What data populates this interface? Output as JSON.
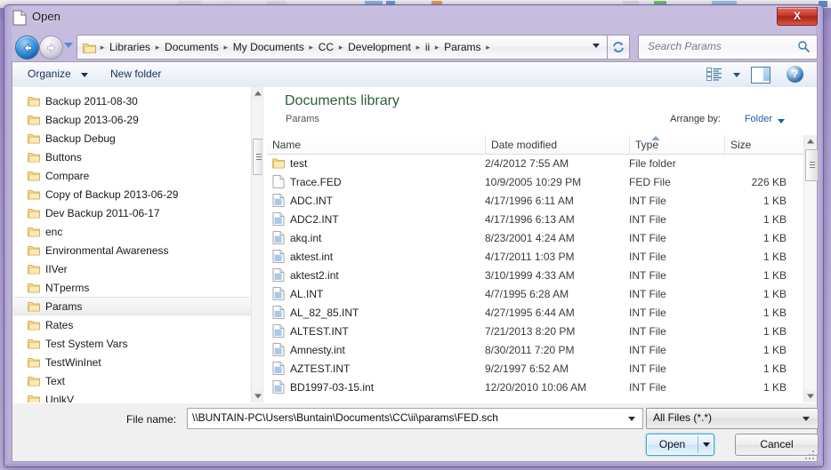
{
  "window": {
    "title": "Open",
    "close_label": "X",
    "icon": "document-window-icon"
  },
  "address_bar": {
    "back_icon": "back-arrow-icon",
    "forward_icon": "forward-arrow-icon",
    "recent_locations_icon": "chevron-down-icon",
    "folder_icon": "folder-icon",
    "breadcrumbs": [
      "Libraries",
      "Documents",
      "My Documents",
      "CC",
      "Development",
      "ii",
      "Params"
    ],
    "separator": "▸",
    "refresh_icon": "refresh-icon",
    "dropdown_icon": "chevron-down-icon"
  },
  "search": {
    "placeholder": "Search Params",
    "icon": "search-icon"
  },
  "toolbar": {
    "organize_label": "Organize",
    "new_folder_label": "New folder",
    "view_mode_icon": "list-view-icon",
    "preview_pane_icon": "preview-pane-icon",
    "help_icon": "help-icon",
    "help_glyph": "?"
  },
  "nav_pane": {
    "items": [
      {
        "label": "Backup 2011-08-30",
        "selected": false
      },
      {
        "label": "Backup 2013-06-29",
        "selected": false
      },
      {
        "label": "Backup Debug",
        "selected": false
      },
      {
        "label": "Buttons",
        "selected": false
      },
      {
        "label": "Compare",
        "selected": false
      },
      {
        "label": "Copy of Backup 2013-06-29",
        "selected": false
      },
      {
        "label": "Dev Backup 2011-06-17",
        "selected": false
      },
      {
        "label": "enc",
        "selected": false
      },
      {
        "label": "Environmental Awareness",
        "selected": false
      },
      {
        "label": "IIVer",
        "selected": false
      },
      {
        "label": "NTperms",
        "selected": false
      },
      {
        "label": "Params",
        "selected": true
      },
      {
        "label": "Rates",
        "selected": false
      },
      {
        "label": "Test System Vars",
        "selected": false
      },
      {
        "label": "TestWinInet",
        "selected": false
      },
      {
        "label": "Text",
        "selected": false
      },
      {
        "label": "UnlkV",
        "selected": false
      }
    ],
    "folder_icon": "folder-icon",
    "scroll_up_icon": "scroll-up-arrow-icon",
    "scroll_down_icon": "scroll-down-arrow-icon"
  },
  "library": {
    "title": "Documents library",
    "subtitle": "Params",
    "arrange_label": "Arrange by:",
    "arrange_value": "Folder",
    "arrange_caret_icon": "chevron-down-icon"
  },
  "file_list": {
    "columns": [
      "Name",
      "Date modified",
      "Type",
      "Size"
    ],
    "sort_column": "Type",
    "sort_direction": "ascending",
    "sort_icon": "sort-ascending-icon",
    "rows": [
      {
        "name": "test",
        "date": "2/4/2012 7:55 AM",
        "type": "File folder",
        "size": "",
        "icon": "folder-icon"
      },
      {
        "name": "Trace.FED",
        "date": "10/9/2005 10:29 PM",
        "type": "FED File",
        "size": "226 KB",
        "icon": "blank-file-icon"
      },
      {
        "name": "ADC.INT",
        "date": "4/17/1996 6:11 AM",
        "type": "INT File",
        "size": "1 KB",
        "icon": "int-file-icon"
      },
      {
        "name": "ADC2.INT",
        "date": "4/17/1996 6:13 AM",
        "type": "INT File",
        "size": "1 KB",
        "icon": "int-file-icon"
      },
      {
        "name": "akq.int",
        "date": "8/23/2001 4:24 AM",
        "type": "INT File",
        "size": "1 KB",
        "icon": "int-file-icon"
      },
      {
        "name": "aktest.int",
        "date": "4/17/2011 1:03 PM",
        "type": "INT File",
        "size": "1 KB",
        "icon": "int-file-icon"
      },
      {
        "name": "aktest2.int",
        "date": "3/10/1999 4:33 AM",
        "type": "INT File",
        "size": "1 KB",
        "icon": "int-file-icon"
      },
      {
        "name": "AL.INT",
        "date": "4/7/1995 6:28 AM",
        "type": "INT File",
        "size": "1 KB",
        "icon": "int-file-icon"
      },
      {
        "name": "AL_82_85.INT",
        "date": "4/27/1995 6:44 AM",
        "type": "INT File",
        "size": "1 KB",
        "icon": "int-file-icon"
      },
      {
        "name": "ALTEST.INT",
        "date": "7/21/2013 8:20 PM",
        "type": "INT File",
        "size": "1 KB",
        "icon": "int-file-icon"
      },
      {
        "name": "Amnesty.int",
        "date": "8/30/2011 7:20 PM",
        "type": "INT File",
        "size": "1 KB",
        "icon": "int-file-icon"
      },
      {
        "name": "AZTEST.INT",
        "date": "9/2/1997 6:52 AM",
        "type": "INT File",
        "size": "1 KB",
        "icon": "int-file-icon"
      },
      {
        "name": "BD1997-03-15.int",
        "date": "12/20/2010 10:06 AM",
        "type": "INT File",
        "size": "1 KB",
        "icon": "int-file-icon"
      }
    ]
  },
  "footer": {
    "file_name_label": "File name:",
    "file_name_value": "\\\\BUNTAIN-PC\\Users\\Buntain\\Documents\\CC\\ii\\params\\FED.sch",
    "file_name_caret_icon": "chevron-down-icon",
    "filter_value": "All Files (*.*)",
    "filter_caret_icon": "chevron-down-icon",
    "open_label": "Open",
    "open_caret_icon": "chevron-down-icon",
    "cancel_label": "Cancel",
    "resize_grip_icon": "resize-grip-icon"
  },
  "colors": {
    "glass": "#bdb2da",
    "library_title": "#2a6136",
    "link": "#1a5fa8",
    "accent_button_border": "#3fa3d4",
    "close_button": "#c63b2c"
  }
}
